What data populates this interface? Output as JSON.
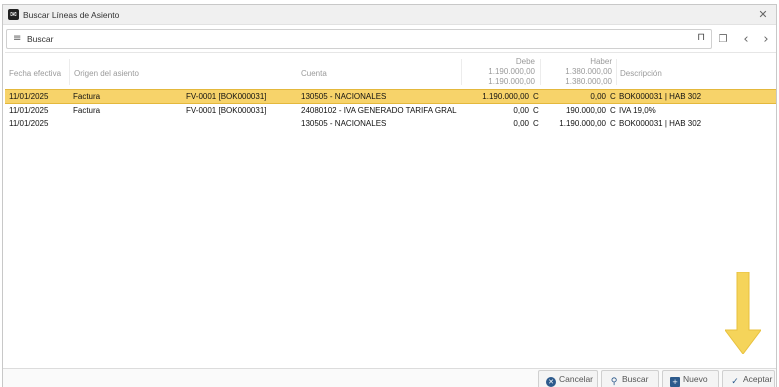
{
  "window": {
    "title": "Buscar Líneas de Asiento",
    "app_icon": "app-logo-icon",
    "close_glyph": "✕"
  },
  "toolbar": {
    "search_placeholder": "Buscar",
    "filter_glyph": "≡",
    "bookmark_glyph": "⊓",
    "pages_glyph": "❐",
    "prev_glyph": "‹",
    "next_glyph": "›"
  },
  "table": {
    "headers": {
      "fecha": "Fecha efectiva",
      "origen": "Origen del asiento",
      "cuenta": "Cuenta",
      "debe": "Debe",
      "debe_total_1": "1.190.000,00",
      "debe_total_2": "1.190.000,00",
      "haber": "Haber",
      "haber_total_1": "1.380.000,00",
      "haber_total_2": "1.380.000,00",
      "descripcion": "Descripción"
    },
    "rows": [
      {
        "fecha": "11/01/2025",
        "origen": "Factura",
        "documento": "FV-0001 [BOK000031]",
        "cuenta": "130505 - NACIONALES",
        "debe": "1.190.000,00",
        "debe_mon": "C",
        "haber": "0,00",
        "haber_mon": "C",
        "descripcion": "BOK000031 | HAB 302",
        "selected": true
      },
      {
        "fecha": "11/01/2025",
        "origen": "Factura",
        "documento": "FV-0001 [BOK000031]",
        "cuenta": "24080102 - IVA GENERADO TARIFA GRAL",
        "debe": "0,00",
        "debe_mon": "C",
        "haber": "190.000,00",
        "haber_mon": "C",
        "descripcion": "IVA 19,0%",
        "selected": false
      },
      {
        "fecha": "11/01/2025",
        "origen": "",
        "documento": "",
        "cuenta": "130505 - NACIONALES",
        "debe": "0,00",
        "debe_mon": "C",
        "haber": "1.190.000,00",
        "haber_mon": "C",
        "descripcion": "BOK000031 | HAB 302",
        "selected": false
      }
    ]
  },
  "footer": {
    "cancel_label": "Cancelar",
    "search_label": "Buscar",
    "new_label": "Nuevo",
    "accept_label": "Aceptar"
  },
  "colors": {
    "selected_row": "#f7d36a",
    "accent": "#2d5a8c",
    "arrow": "#f5d45a"
  }
}
